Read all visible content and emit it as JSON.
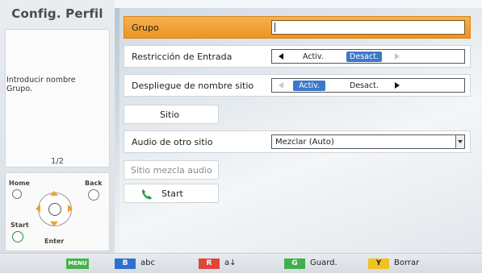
{
  "left_panel": {
    "title": "Config. Perfil",
    "help_text": "Introducir nombre Grupo.",
    "page": "1/2",
    "remote": {
      "home_label": "Home",
      "back_label": "Back",
      "start_label": "Start",
      "enter_label": "Enter"
    }
  },
  "form": {
    "group": {
      "label": "Grupo",
      "value": ""
    },
    "input_restriction": {
      "label": "Restricción de Entrada",
      "option_on": "Activ.",
      "option_off": "Desact.",
      "selected": "Desact."
    },
    "site_name_display": {
      "label": "Despliegue de nombre sitio",
      "option_on": "Activ.",
      "option_off": "Desact.",
      "selected": "Activ."
    },
    "site_button": {
      "label": "Sitio"
    },
    "other_site_audio": {
      "label": "Audio de otro sitio",
      "value": "Mezclar (Auto)"
    },
    "mix_audio_button": {
      "label": "Sitio mezcla audio"
    },
    "start_button": {
      "label": "Start"
    }
  },
  "bottom_bar": {
    "menu_key": "MENU",
    "keys": [
      {
        "key": "B",
        "label": "abc",
        "color": "#2f6fd1"
      },
      {
        "key": "R",
        "label": "a↓",
        "color": "#e0453b"
      },
      {
        "key": "G",
        "label": "Guard.",
        "color": "#3fb04c"
      },
      {
        "key": "Y",
        "label": "Borrar",
        "color": "#f1c21f"
      }
    ]
  },
  "colors": {
    "accent_orange": "#ec9422",
    "toggle_blue": "#3c78c8",
    "menu_green": "#46b24f"
  }
}
